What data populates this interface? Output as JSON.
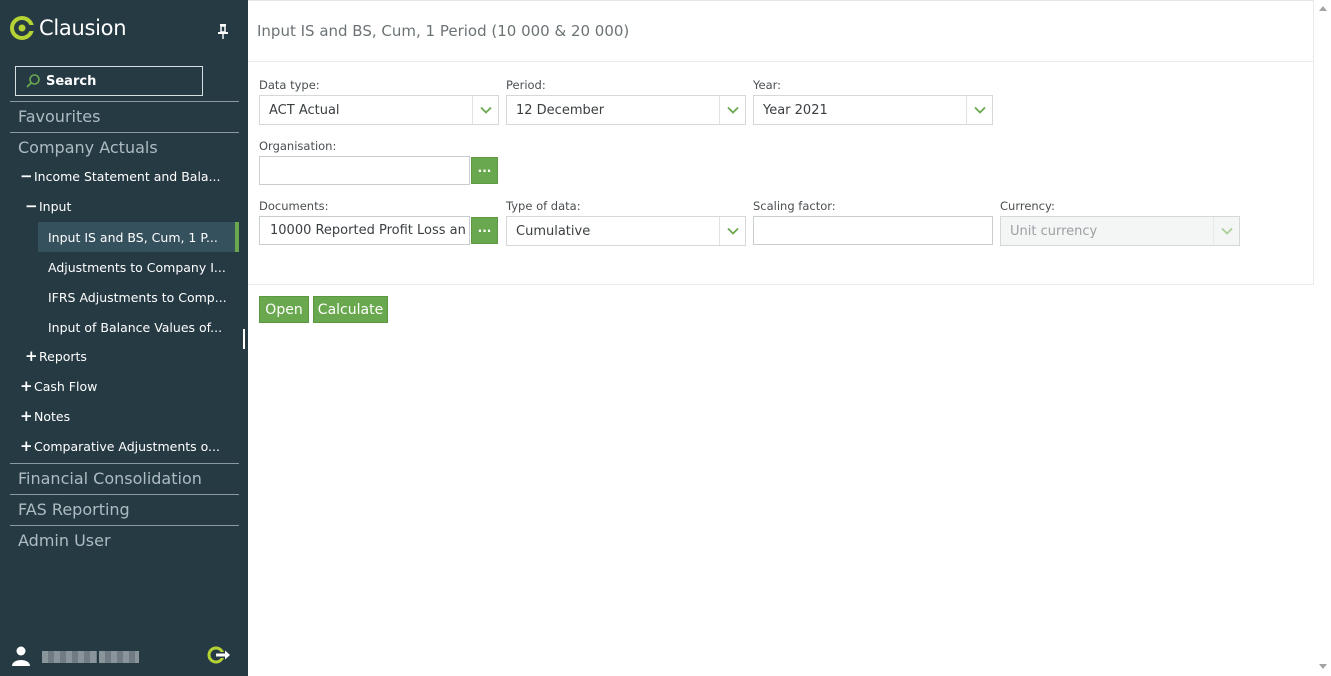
{
  "app": {
    "logo_text": "Clausion",
    "brand_color": "#6aa84f",
    "sidebar_color": "#263a44"
  },
  "sidebar": {
    "search_label": "Search",
    "sections": {
      "favourites": "Favourites",
      "company_actuals": "Company Actuals",
      "financial_consolidation": "Financial Consolidation",
      "fas_reporting": "FAS Reporting",
      "admin_user": "Admin User"
    },
    "tree": {
      "income_statement": {
        "sign": "−",
        "label": "Income Statement and Bala..."
      },
      "input": {
        "sign": "−",
        "label": "Input"
      },
      "sub_items": [
        {
          "label": "Input IS and BS, Cum, 1 P...",
          "active": true
        },
        {
          "label": "Adjustments to Company I...",
          "active": false
        },
        {
          "label": "IFRS Adjustments to Comp...",
          "active": false
        },
        {
          "label": "Input of Balance Values of...",
          "active": false
        }
      ],
      "reports": {
        "sign": "+",
        "label": "Reports"
      },
      "cash_flow": {
        "sign": "+",
        "label": "Cash Flow"
      },
      "notes": {
        "sign": "+",
        "label": "Notes"
      },
      "comparative": {
        "sign": "+",
        "label": "Comparative Adjustments o..."
      }
    }
  },
  "main": {
    "title": "Input IS and BS, Cum, 1 Period (10 000 & 20 000)",
    "fields": {
      "data_type": {
        "label": "Data type:",
        "value": "ACT Actual"
      },
      "period": {
        "label": "Period:",
        "value": "12 December"
      },
      "year": {
        "label": "Year:",
        "value": "Year 2021"
      },
      "organisation": {
        "label": "Organisation:",
        "value": "",
        "button": "···"
      },
      "documents": {
        "label": "Documents:",
        "value": "10000 Reported Profit Loss an",
        "button": "···"
      },
      "type_of_data": {
        "label": "Type of data:",
        "value": "Cumulative"
      },
      "scaling_factor": {
        "label": "Scaling factor:",
        "value": ""
      },
      "currency": {
        "label": "Currency:",
        "value": "Unit currency"
      }
    },
    "buttons": {
      "open": "Open",
      "calculate": "Calculate"
    }
  }
}
